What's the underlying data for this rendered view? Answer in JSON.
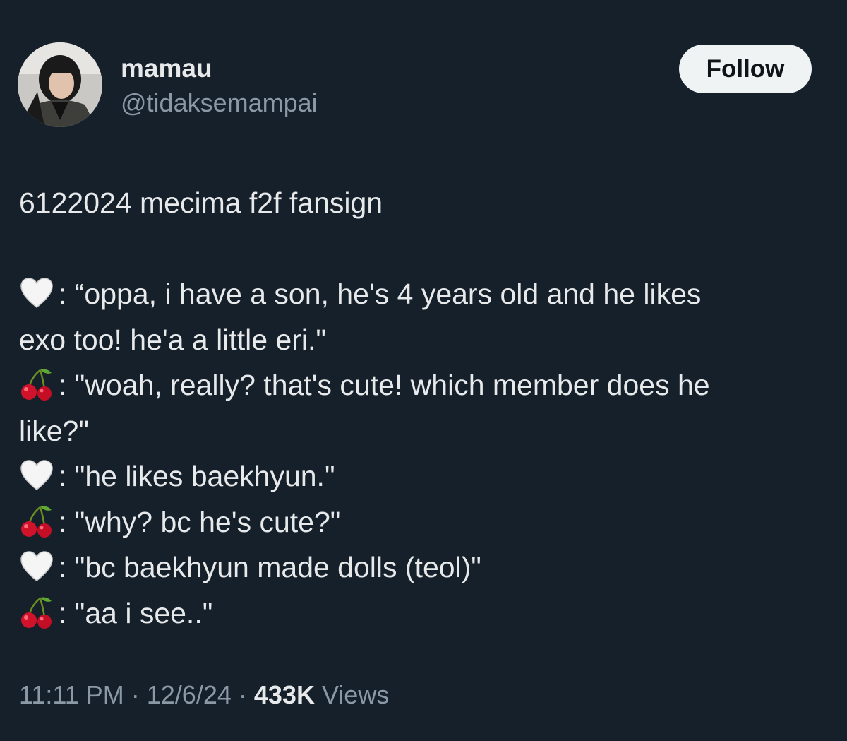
{
  "author": {
    "display_name": "mamau",
    "handle": "@tidaksemampai",
    "avatar_icon": "profile-photo"
  },
  "follow_button": {
    "label": "Follow"
  },
  "tweet": {
    "heading": "6122024 mecima f2f fansign",
    "lines": [
      {
        "speaker_icon": "white-heart-icon",
        "text_1": ": “oppa, i have a son, he's 4 years old and he likes",
        "text_2": "exo too! he'a a little eri.\""
      },
      {
        "speaker_icon": "cherries-icon",
        "text_1": ": \"woah, really? that's cute! which member does he",
        "text_2": "like?\""
      },
      {
        "speaker_icon": "white-heart-icon",
        "text_1": ": \"he likes baekhyun.\""
      },
      {
        "speaker_icon": "cherries-icon",
        "text_1": ": \"why? bc he's cute?\""
      },
      {
        "speaker_icon": "white-heart-icon",
        "text_1": ": \"bc baekhyun made dolls (teol)\""
      },
      {
        "speaker_icon": "cherries-icon",
        "text_1": ": \"aa i see..\""
      }
    ]
  },
  "meta": {
    "time": "11:11 PM",
    "separator": " · ",
    "date": "12/6/24",
    "views_count": "433K",
    "views_label": " Views"
  },
  "colors": {
    "background": "#15202b",
    "text_primary": "#e7e9ea",
    "text_secondary": "#8b98a5",
    "button_bg": "#eff3f4"
  }
}
